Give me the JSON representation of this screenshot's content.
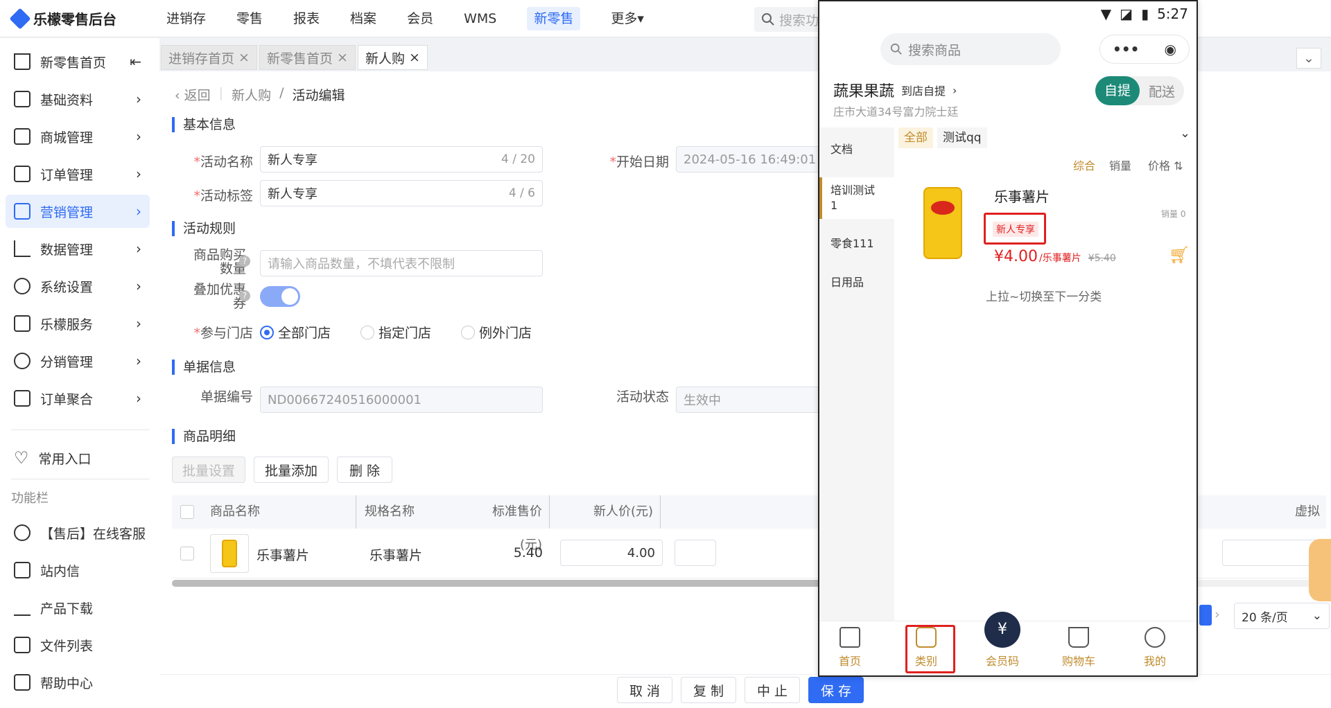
{
  "app": {
    "title": "乐檬零售后台"
  },
  "nav": {
    "items": [
      "进销存",
      "零售",
      "报表",
      "档案",
      "会员",
      "WMS",
      "新零售",
      "更多▾"
    ],
    "active_index": 6,
    "search_placeholder": "搜索功"
  },
  "sidebar": {
    "items": [
      {
        "label": "新零售首页",
        "trail": "⇤"
      },
      {
        "label": "基础资料",
        "trail": "›"
      },
      {
        "label": "商城管理",
        "trail": "›"
      },
      {
        "label": "订单管理",
        "trail": "›"
      },
      {
        "label": "营销管理",
        "trail": "›"
      },
      {
        "label": "数据管理",
        "trail": "›"
      },
      {
        "label": "系统设置",
        "trail": "›"
      },
      {
        "label": "乐檬服务",
        "trail": "›"
      },
      {
        "label": "分销管理",
        "trail": "›"
      },
      {
        "label": "订单聚合",
        "trail": "›"
      }
    ],
    "active_index": 4,
    "common_entry": "常用入口",
    "function_bar_label": "功能栏",
    "function_items": [
      "【售后】在线客服",
      "站内信",
      "产品下载",
      "文件列表",
      "帮助中心"
    ]
  },
  "tabs": [
    {
      "label": "进销存首页",
      "close": "×"
    },
    {
      "label": "新零售首页",
      "close": "×"
    },
    {
      "label": "新人购",
      "close": "×"
    }
  ],
  "breadcrumb": {
    "back": "返回",
    "parent": "新人购",
    "separator": "/",
    "current": "活动编辑"
  },
  "basic_info": {
    "title": "基本信息",
    "name_label": "活动名称",
    "name_value": "新人专享",
    "name_count": "4 / 20",
    "start_label": "开始日期",
    "start_value": "2024-05-16 16:49:01",
    "tag_label": "活动标签",
    "tag_value": "新人专享",
    "tag_count": "4 / 6"
  },
  "rules": {
    "title": "活动规则",
    "qty_label_1": "商品购买",
    "qty_label_2": "数量",
    "qty_placeholder": "请输入商品数量，不填代表不限制",
    "stack_label_1": "叠加优惠",
    "stack_label_2": "券",
    "help_mark": "?",
    "store_label": "参与门店",
    "store_options": [
      "全部门店",
      "指定门店",
      "例外门店"
    ],
    "store_selected": 0
  },
  "doc_info": {
    "title": "单据信息",
    "doc_no_label": "单据编号",
    "doc_no_value": "ND00667240516000001",
    "status_label": "活动状态",
    "status_value": "生效中"
  },
  "goods": {
    "title": "商品明细",
    "buttons": [
      "批量设置",
      "批量添加",
      "删 除"
    ],
    "columns": [
      "商品名称",
      "规格名称",
      "标准售价(元)",
      "新人价(元)",
      "虚拟"
    ],
    "rows": [
      {
        "name": "乐事薯片",
        "spec": "乐事薯片",
        "std_price": "5.40",
        "new_price": "4.00"
      }
    ],
    "page_size": "20 条/页"
  },
  "footer": {
    "buttons": [
      "取 消",
      "复 制",
      "中 止",
      "保 存"
    ]
  },
  "phone": {
    "time": "5:27",
    "search_placeholder": "搜索商品",
    "capsule_more": "•••",
    "capsule_target": "◉",
    "store_name": "蔬果果蔬",
    "store_mode_hint": "到店自提",
    "store_chevron": "›",
    "store_address": "庄市大道34号富力院士廷",
    "mode_options": [
      "自提",
      "配送"
    ],
    "categories": [
      {
        "label": "文档"
      },
      {
        "label": "培训测试\n1"
      },
      {
        "label": "零食111"
      },
      {
        "label": "日用品"
      }
    ],
    "active_category": 1,
    "chips": [
      "全部",
      "测试qq"
    ],
    "chip_arrow": "⌄",
    "sorts": [
      "综合",
      "销量",
      "价格 ⇅"
    ],
    "product": {
      "name": "乐事薯片",
      "tag": "新人专享",
      "sales": "销量 0",
      "price": "¥4.00",
      "price_suffix": "/乐事薯片",
      "orig_price": "¥5.40"
    },
    "pull_hint": "上拉~切换至下一分类",
    "tabbar": [
      "首页",
      "类别",
      "会员码",
      "购物车",
      "我的"
    ],
    "active_tab": 1,
    "accent": "#c08b2c"
  }
}
